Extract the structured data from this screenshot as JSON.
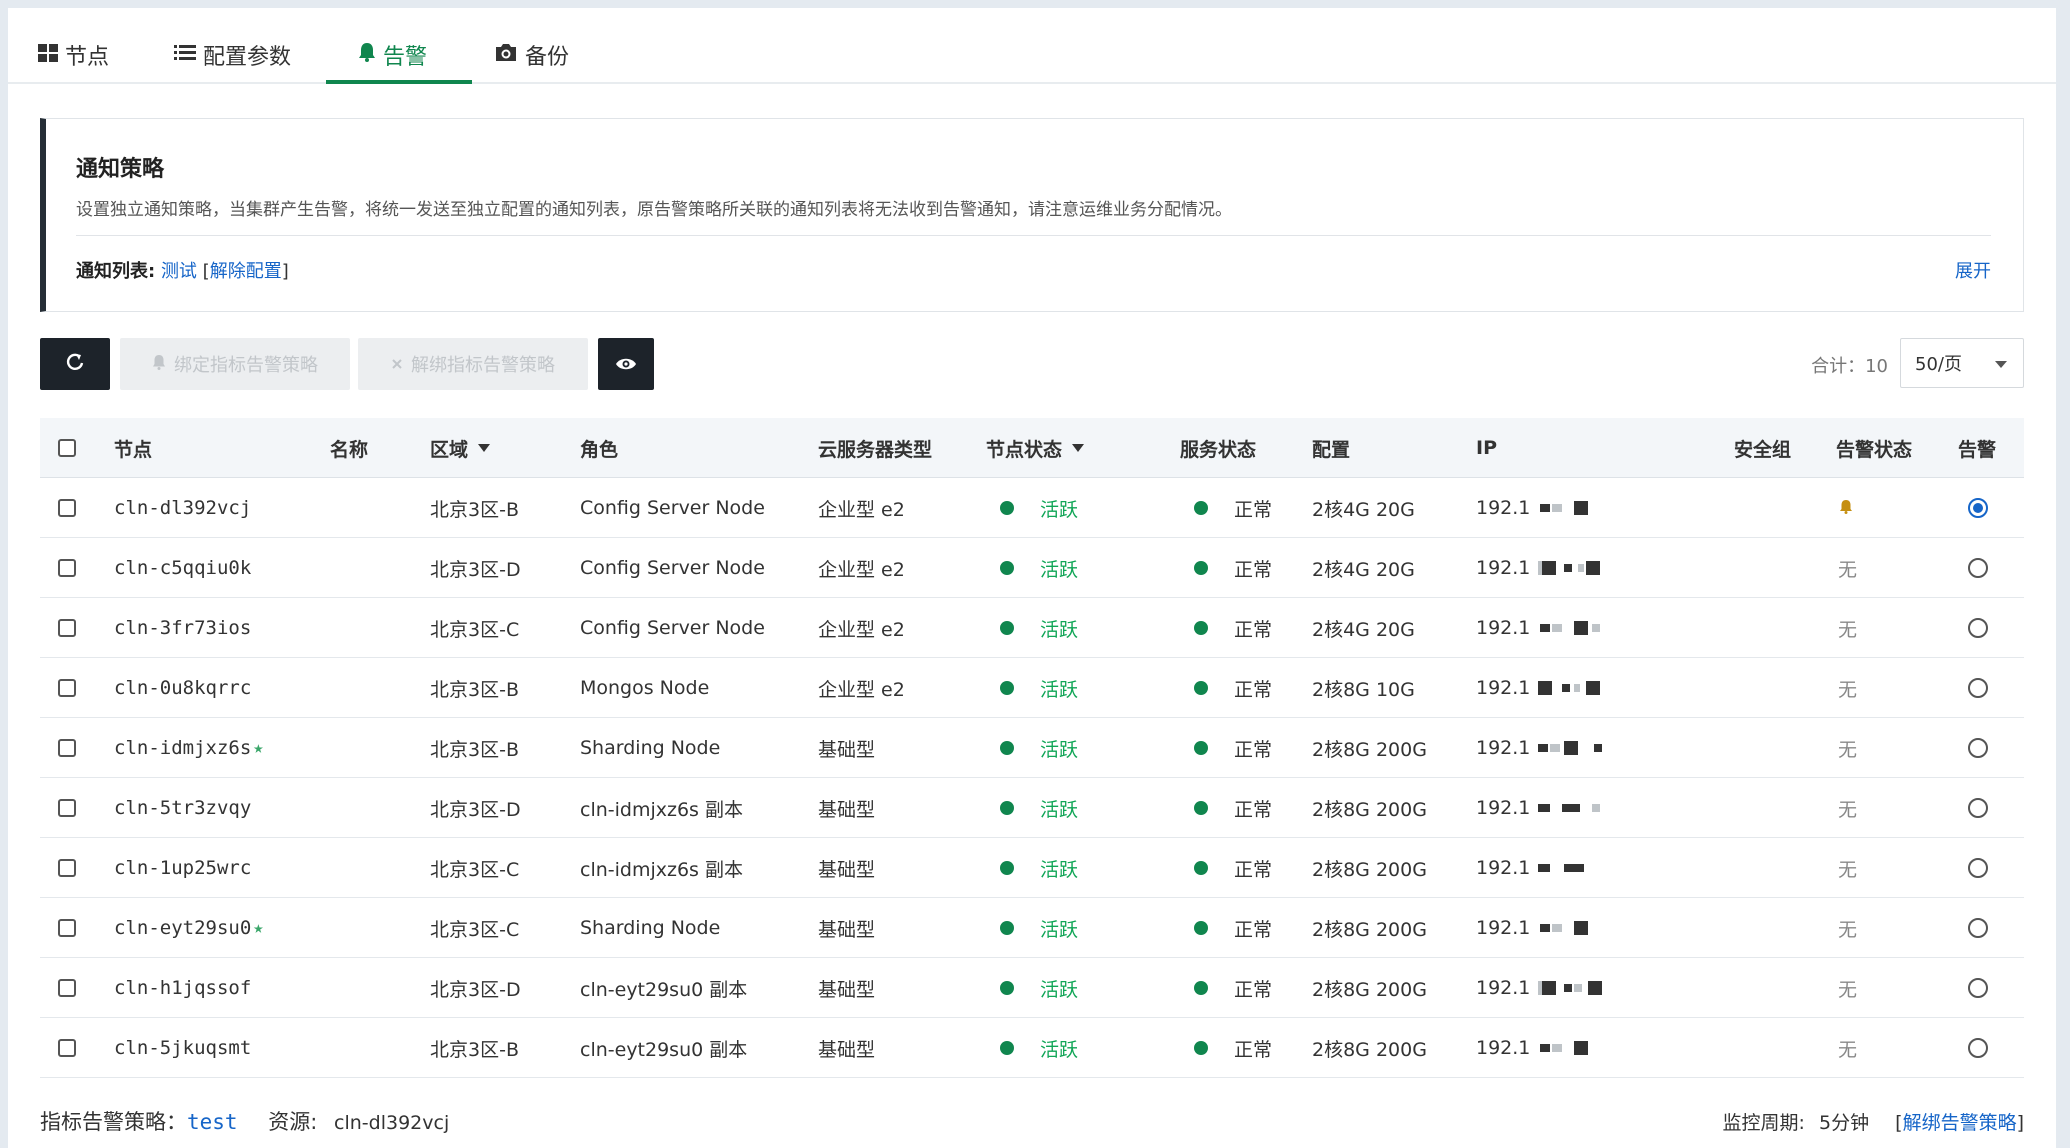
{
  "tabs": [
    {
      "label": "节点",
      "icon": "grid-icon"
    },
    {
      "label": "配置参数",
      "icon": "list-icon"
    },
    {
      "label": "告警",
      "icon": "bell-icon",
      "active": true
    },
    {
      "label": "备份",
      "icon": "camera-icon"
    }
  ],
  "notice": {
    "title": "通知策略",
    "description": "设置独立通知策略，当集群产生告警，将统一发送至独立配置的通知列表，原告警策略所关联的通知列表将无法收到告警通知，请注意运维业务分配情况。",
    "list_label": "通知列表:",
    "list_value": "测试",
    "unbind_label": "解除配置",
    "bracket_open": "[",
    "bracket_close": "]",
    "expand_label": "展开"
  },
  "toolbar": {
    "refresh_icon": "refresh-icon",
    "bind_label": "绑定指标告警策略",
    "unbind_label": "解绑指标告警策略",
    "bind_icon": "bell-icon",
    "unbind_icon": "close-icon",
    "view_icon": "eye-icon",
    "total_label": "合计：10",
    "page_size": "50/页"
  },
  "table": {
    "columns": [
      "节点",
      "名称",
      "区域",
      "角色",
      "云服务器类型",
      "节点状态",
      "服务状态",
      "配置",
      "IP",
      "安全组",
      "告警状态",
      "告警"
    ],
    "rows": [
      {
        "node": "cln-dl392vcj",
        "star": false,
        "region": "北京3区-B",
        "role": "Config Server Node",
        "type": "企业型 e2",
        "node_status": "活跃",
        "service_status": "正常",
        "config": "2核4G 20G",
        "ip": "192.1",
        "alarm_status": "",
        "alarm_status_icon": "bell-icon",
        "selected": true
      },
      {
        "node": "cln-c5qqiu0k",
        "star": false,
        "region": "北京3区-D",
        "role": "Config Server Node",
        "type": "企业型 e2",
        "node_status": "活跃",
        "service_status": "正常",
        "config": "2核4G 20G",
        "ip": "192.1",
        "alarm_status": "无",
        "selected": false
      },
      {
        "node": "cln-3fr73ios",
        "star": false,
        "region": "北京3区-C",
        "role": "Config Server Node",
        "type": "企业型 e2",
        "node_status": "活跃",
        "service_status": "正常",
        "config": "2核4G 20G",
        "ip": "192.1",
        "alarm_status": "无",
        "selected": false
      },
      {
        "node": "cln-0u8kqrrc",
        "star": false,
        "region": "北京3区-B",
        "role": "Mongos Node",
        "type": "企业型 e2",
        "node_status": "活跃",
        "service_status": "正常",
        "config": "2核8G 10G",
        "ip": "192.1",
        "alarm_status": "无",
        "selected": false
      },
      {
        "node": "cln-idmjxz6s",
        "star": true,
        "region": "北京3区-B",
        "role": "Sharding Node",
        "type": "基础型",
        "node_status": "活跃",
        "service_status": "正常",
        "config": "2核8G 200G",
        "ip": "192.1",
        "alarm_status": "无",
        "selected": false
      },
      {
        "node": "cln-5tr3zvqy",
        "star": false,
        "region": "北京3区-D",
        "role": "cln-idmjxz6s 副本",
        "type": "基础型",
        "node_status": "活跃",
        "service_status": "正常",
        "config": "2核8G 200G",
        "ip": "192.1",
        "alarm_status": "无",
        "selected": false
      },
      {
        "node": "cln-1up25wrc",
        "star": false,
        "region": "北京3区-C",
        "role": "cln-idmjxz6s 副本",
        "type": "基础型",
        "node_status": "活跃",
        "service_status": "正常",
        "config": "2核8G 200G",
        "ip": "192.1",
        "alarm_status": "无",
        "selected": false
      },
      {
        "node": "cln-eyt29su0",
        "star": true,
        "region": "北京3区-C",
        "role": "Sharding Node",
        "type": "基础型",
        "node_status": "活跃",
        "service_status": "正常",
        "config": "2核8G 200G",
        "ip": "192.1",
        "alarm_status": "无",
        "selected": false
      },
      {
        "node": "cln-h1jqssof",
        "star": false,
        "region": "北京3区-D",
        "role": "cln-eyt29su0 副本",
        "type": "基础型",
        "node_status": "活跃",
        "service_status": "正常",
        "config": "2核8G 200G",
        "ip": "192.1",
        "alarm_status": "无",
        "selected": false
      },
      {
        "node": "cln-5jkuqsmt",
        "star": false,
        "region": "北京3区-B",
        "role": "cln-eyt29su0 副本",
        "type": "基础型",
        "node_status": "活跃",
        "service_status": "正常",
        "config": "2核8G 200G",
        "ip": "192.1",
        "alarm_status": "无",
        "selected": false
      }
    ],
    "star_glyph": "★"
  },
  "footer": {
    "policy_label": "指标告警策略：",
    "policy_value": "test",
    "resource_label": "资源:",
    "resource_value": "cln-dl392vcj",
    "period_label": "监控周期:",
    "period_value": "5分钟",
    "unbind_label": "解绑告警策略",
    "bracket_open": "[",
    "bracket_close": "]"
  },
  "colors": {
    "accent": "#10864e",
    "link": "#1665c8",
    "active_text": "#10a556",
    "dark_button": "#1d232a"
  }
}
